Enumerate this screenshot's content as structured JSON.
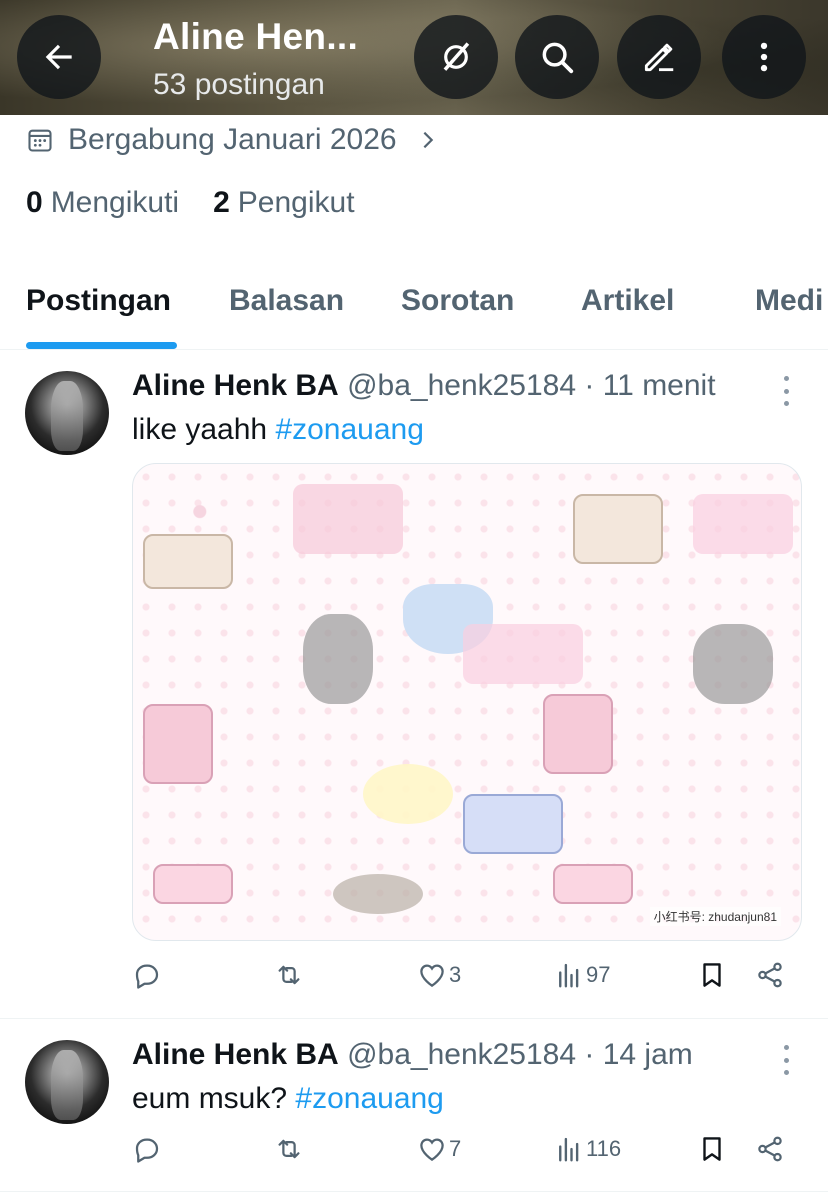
{
  "header": {
    "title": "Aline Hen...",
    "subtitle": "53 postingan"
  },
  "profile": {
    "joined": "Bergabung Januari 2026",
    "following_count": "0",
    "following_label": "Mengikuti",
    "followers_count": "2",
    "followers_label": "Pengikut"
  },
  "tabs": [
    {
      "label": "Postingan",
      "active": true
    },
    {
      "label": "Balasan",
      "active": false
    },
    {
      "label": "Sorotan",
      "active": false
    },
    {
      "label": "Artikel",
      "active": false
    },
    {
      "label": "Medi",
      "active": false
    }
  ],
  "posts": [
    {
      "name": "Aline Henk BA",
      "handle": "@ba_henk25184",
      "time": "· 11 menit",
      "text": "like yaahh ",
      "hashtag": "#zonauang",
      "media_watermark": "小红书号: zhudanjun81",
      "likes": "3",
      "views": "97"
    },
    {
      "name": "Aline Henk BA",
      "handle": "@ba_henk25184",
      "time": "· 14 jam",
      "text": "eum msuk? ",
      "hashtag": "#zonauang",
      "likes": "7",
      "views": "116"
    }
  ],
  "colors": {
    "accent": "#1d9bf0",
    "text_primary": "#0f1419",
    "text_secondary": "#536471"
  }
}
